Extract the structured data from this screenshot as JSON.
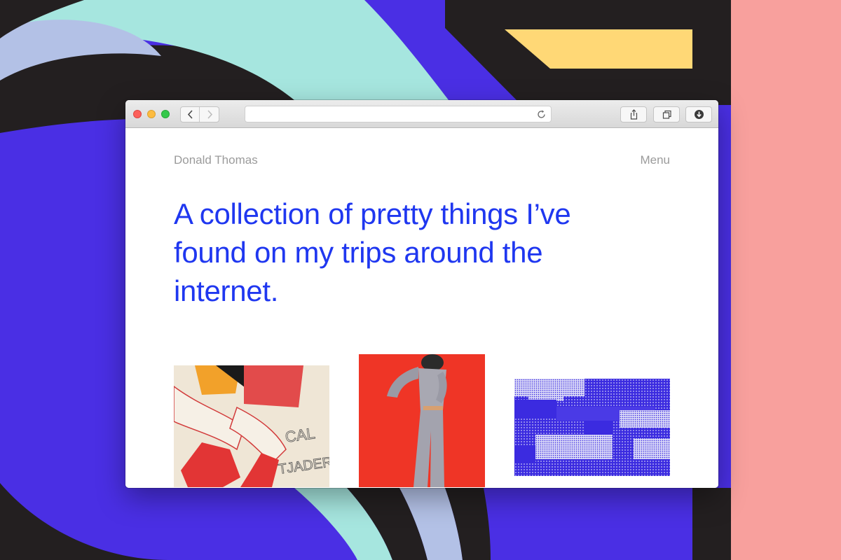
{
  "colors": {
    "background_dark": "#231f20",
    "background_blue": "#4a2fe4",
    "background_mint": "#a6e6df",
    "background_lavender": "#b3c1e6",
    "background_yellow": "#ffd876",
    "background_pink": "#f8a09d",
    "headline_blue": "#1f37f0",
    "muted_text": "#9b9b9b"
  },
  "browser": {
    "toolbar": {
      "back_icon": "chevron-left-icon",
      "forward_icon": "chevron-right-icon",
      "address_value": "",
      "reload_icon": "reload-icon",
      "share_icon": "share-icon",
      "tabs_icon": "tabs-icon",
      "download_icon": "download-icon"
    }
  },
  "page": {
    "site_name": "Donald Thomas",
    "menu_label": "Menu",
    "headline": "A collection of pretty things I’ve found on my trips around the internet."
  },
  "gallery": [
    {
      "name": "album-cover-thumbnail",
      "text": "CAL TJADER"
    },
    {
      "name": "fashion-photo-thumbnail",
      "text": ""
    },
    {
      "name": "blue-pattern-thumbnail",
      "text": ""
    }
  ]
}
